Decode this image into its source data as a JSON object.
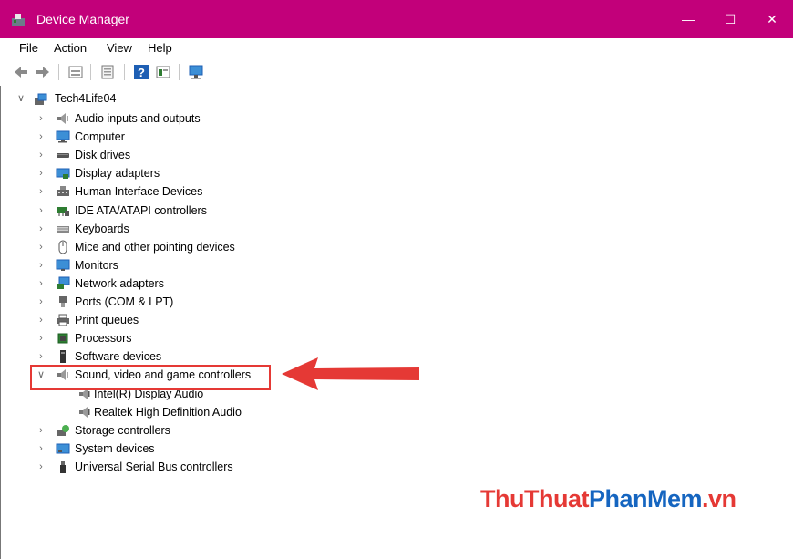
{
  "window": {
    "title": "Device Manager",
    "minimize": "—",
    "maximize": "☐",
    "close": "✕"
  },
  "menu": [
    "File",
    "Action",
    "View",
    "Help"
  ],
  "toolbar": {
    "buttons": [
      "back-icon",
      "forward-icon",
      "properties-icon",
      "update-driver-icon",
      "help-icon",
      "view-icon",
      "monitor-icon"
    ]
  },
  "tree": {
    "root": "Tech4Life04",
    "categories": [
      {
        "label": "Audio inputs and outputs",
        "icon": "speaker-icon"
      },
      {
        "label": "Computer",
        "icon": "computer-icon"
      },
      {
        "label": "Disk drives",
        "icon": "disk-drive-icon"
      },
      {
        "label": "Display adapters",
        "icon": "display-adapter-icon"
      },
      {
        "label": "Human Interface Devices",
        "icon": "hid-icon"
      },
      {
        "label": "IDE ATA/ATAPI controllers",
        "icon": "ide-controller-icon"
      },
      {
        "label": "Keyboards",
        "icon": "keyboard-icon"
      },
      {
        "label": "Mice and other pointing devices",
        "icon": "mouse-icon"
      },
      {
        "label": "Monitors",
        "icon": "monitor-icon"
      },
      {
        "label": "Network adapters",
        "icon": "network-adapter-icon"
      },
      {
        "label": "Ports (COM & LPT)",
        "icon": "port-icon"
      },
      {
        "label": "Print queues",
        "icon": "printer-icon"
      },
      {
        "label": "Processors",
        "icon": "processor-icon"
      },
      {
        "label": "Software devices",
        "icon": "software-device-icon"
      },
      {
        "label": "Sound, video and game controllers",
        "icon": "speaker-icon",
        "expanded": true
      },
      {
        "label": "Intel(R) Display Audio",
        "icon": "speaker-icon",
        "child": true
      },
      {
        "label": "Realtek High Definition Audio",
        "icon": "speaker-icon",
        "child": true
      },
      {
        "label": "Storage controllers",
        "icon": "storage-controller-icon"
      },
      {
        "label": "System devices",
        "icon": "system-device-icon"
      },
      {
        "label": "Universal Serial Bus controllers",
        "icon": "usb-icon"
      }
    ]
  },
  "watermark": {
    "part1": "ThuThuat",
    "part2": "PhanMem",
    "part3": ".vn"
  },
  "colors": {
    "titlebar": "#c2007a",
    "highlight": "#e53935",
    "arrow": "#e53935"
  }
}
